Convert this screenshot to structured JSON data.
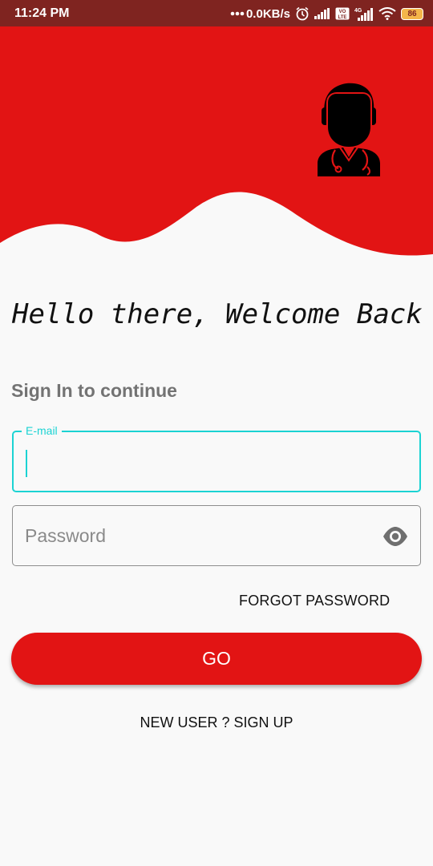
{
  "status_bar": {
    "time": "11:24 PM",
    "network_speed": "0.0KB/s",
    "battery": "86",
    "icons": [
      "more-dots-icon",
      "alarm-icon",
      "signal-icon",
      "volte-icon",
      "4g-signal-icon",
      "wifi-icon",
      "battery-icon"
    ]
  },
  "header": {
    "avatar_icon": "doctor-icon"
  },
  "greeting": "Hello there, Welcome Back",
  "subtitle": "Sign In to continue",
  "email": {
    "label": "E-mail",
    "value": ""
  },
  "password": {
    "placeholder": "Password",
    "toggle_icon": "eye-icon"
  },
  "forgot_label": "FORGOT PASSWORD",
  "go_label": "GO",
  "signup_label": "NEW USER ? SIGN UP",
  "colors": {
    "status_bar": "#7f2420",
    "brand_red": "#e21414",
    "focus_teal": "#1bd3d3",
    "background": "#f9f9f9"
  }
}
